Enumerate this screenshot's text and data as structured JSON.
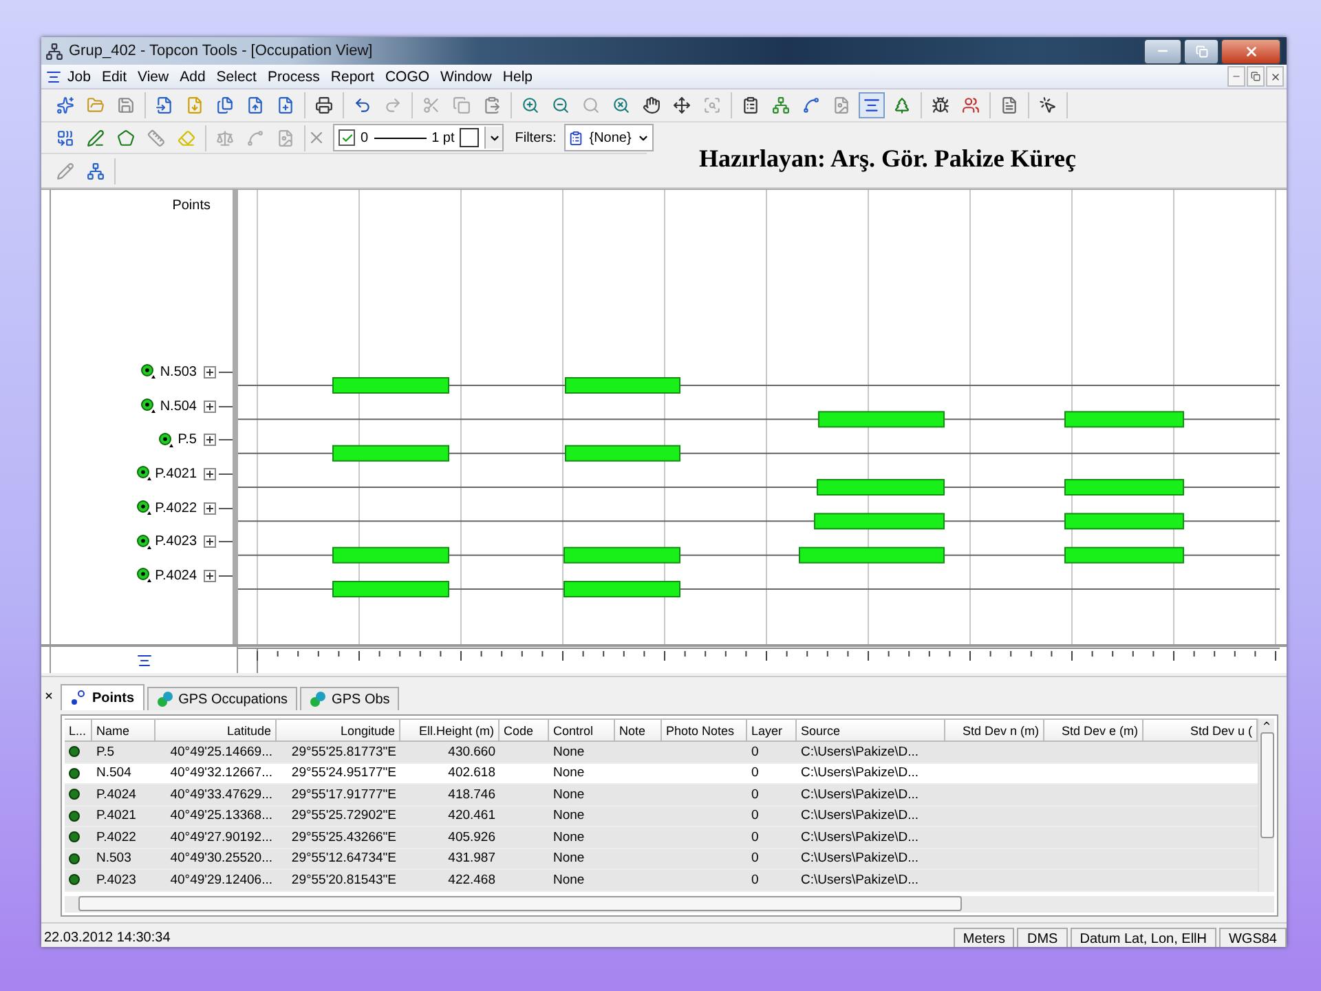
{
  "window": {
    "title": "Grup_402 - Topcon Tools - [Occupation View]"
  },
  "menu": [
    "Job",
    "Edit",
    "View",
    "Add",
    "Select",
    "Process",
    "Report",
    "COGO",
    "Window",
    "Help"
  ],
  "toolbar": {
    "line_style": {
      "checked": true,
      "value": "0",
      "weight": "1 pt"
    },
    "filters_label": "Filters:",
    "filter": "{None}"
  },
  "heading": "Hazırlayan: Arş. Gör. Pakize Küreç",
  "occupation_view": {
    "header": "Points",
    "points": [
      {
        "name": "N.503"
      },
      {
        "name": "N.504"
      },
      {
        "name": "P.5"
      },
      {
        "name": "P.4021"
      },
      {
        "name": "P.4022"
      },
      {
        "name": "P.4023"
      },
      {
        "name": "P.4024"
      }
    ]
  },
  "panel": {
    "tabs": [
      {
        "label": "Points",
        "selected": true
      },
      {
        "label": "GPS Occupations",
        "selected": false
      },
      {
        "label": "GPS Obs",
        "selected": false
      }
    ],
    "table": {
      "columns": [
        "L...",
        "Name",
        "Latitude",
        "Longitude",
        "Ell.Height (m)",
        "Code",
        "Control",
        "Note",
        "Photo Notes",
        "Layer",
        "Source",
        "Std Dev n (m)",
        "Std Dev e (m)",
        "Std Dev u ("
      ],
      "rows": [
        {
          "selected": false,
          "cells": [
            "",
            "P.5",
            "40°49'25.14669...",
            "29°55'25.81773\"E",
            "430.660",
            "",
            "None",
            "",
            "",
            "0",
            "C:\\Users\\Pakize\\D...",
            "",
            "",
            ""
          ]
        },
        {
          "selected": true,
          "cells": [
            "",
            "N.504",
            "40°49'32.12667...",
            "29°55'24.95177\"E",
            "402.618",
            "",
            "None",
            "",
            "",
            "0",
            "C:\\Users\\Pakize\\D...",
            "",
            "",
            ""
          ]
        },
        {
          "selected": false,
          "cells": [
            "",
            "P.4024",
            "40°49'33.47629...",
            "29°55'17.91777\"E",
            "418.746",
            "",
            "None",
            "",
            "",
            "0",
            "C:\\Users\\Pakize\\D...",
            "",
            "",
            ""
          ]
        },
        {
          "selected": false,
          "cells": [
            "",
            "P.4021",
            "40°49'25.13368...",
            "29°55'25.72902\"E",
            "420.461",
            "",
            "None",
            "",
            "",
            "0",
            "C:\\Users\\Pakize\\D...",
            "",
            "",
            ""
          ]
        },
        {
          "selected": false,
          "cells": [
            "",
            "P.4022",
            "40°49'27.90192...",
            "29°55'25.43266\"E",
            "405.926",
            "",
            "None",
            "",
            "",
            "0",
            "C:\\Users\\Pakize\\D...",
            "",
            "",
            ""
          ]
        },
        {
          "selected": false,
          "cells": [
            "",
            "N.503",
            "40°49'30.25520...",
            "29°55'12.64734\"E",
            "431.987",
            "",
            "None",
            "",
            "",
            "0",
            "C:\\Users\\Pakize\\D...",
            "",
            "",
            ""
          ]
        },
        {
          "selected": false,
          "cells": [
            "",
            "P.4023",
            "40°49'29.12406...",
            "29°55'20.81543\"E",
            "422.468",
            "",
            "None",
            "",
            "",
            "0",
            "C:\\Users\\Pakize\\D...",
            "",
            "",
            ""
          ]
        }
      ]
    }
  },
  "status_bar": {
    "timestamp": "22.03.2012 14:30:34",
    "fields": [
      "Meters",
      "DMS",
      "Datum Lat, Lon, EllH",
      "WGS84"
    ]
  }
}
